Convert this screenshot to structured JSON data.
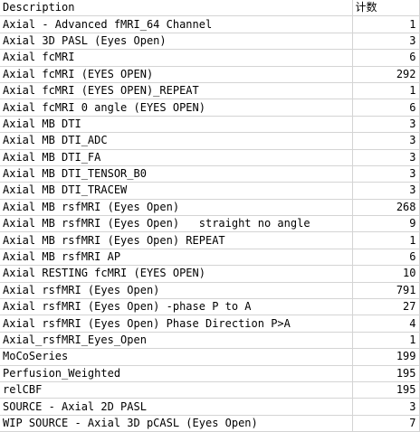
{
  "sheet": {
    "header": {
      "description": "Description",
      "count": "计数"
    },
    "rows": [
      {
        "description": "Axial - Advanced fMRI_64 Channel",
        "count": "1"
      },
      {
        "description": "Axial 3D PASL (Eyes Open)",
        "count": "3"
      },
      {
        "description": "Axial fcMRI",
        "count": "6"
      },
      {
        "description": "Axial fcMRI (EYES OPEN)",
        "count": "292"
      },
      {
        "description": "Axial fcMRI (EYES OPEN)_REPEAT",
        "count": "1"
      },
      {
        "description": "Axial fcMRI 0 angle (EYES OPEN)",
        "count": "6"
      },
      {
        "description": "Axial MB DTI",
        "count": "3"
      },
      {
        "description": "Axial MB DTI_ADC",
        "count": "3"
      },
      {
        "description": "Axial MB DTI_FA",
        "count": "3"
      },
      {
        "description": "Axial MB DTI_TENSOR_B0",
        "count": "3"
      },
      {
        "description": "Axial MB DTI_TRACEW",
        "count": "3"
      },
      {
        "description": "Axial MB rsfMRI (Eyes Open)",
        "count": "268"
      },
      {
        "description": "Axial MB rsfMRI (Eyes Open)   straight no angle",
        "count": "9"
      },
      {
        "description": "Axial MB rsfMRI (Eyes Open) REPEAT",
        "count": "1"
      },
      {
        "description": "Axial MB rsfMRI AP",
        "count": "6"
      },
      {
        "description": "Axial RESTING fcMRI (EYES OPEN)",
        "count": "10"
      },
      {
        "description": "Axial rsfMRI (Eyes Open)",
        "count": "791"
      },
      {
        "description": "Axial rsfMRI (Eyes Open) -phase P to A",
        "count": "27"
      },
      {
        "description": "Axial rsfMRI (Eyes Open) Phase Direction P>A",
        "count": "4"
      },
      {
        "description": "Axial_rsfMRI_Eyes_Open",
        "count": "1"
      },
      {
        "description": "MoCoSeries",
        "count": "199"
      },
      {
        "description": "Perfusion_Weighted",
        "count": "195"
      },
      {
        "description": "relCBF",
        "count": "195"
      },
      {
        "description": "SOURCE - Axial 2D PASL",
        "count": "3"
      },
      {
        "description": "WIP SOURCE - Axial 3D pCASL (Eyes Open)",
        "count": "7"
      }
    ]
  }
}
